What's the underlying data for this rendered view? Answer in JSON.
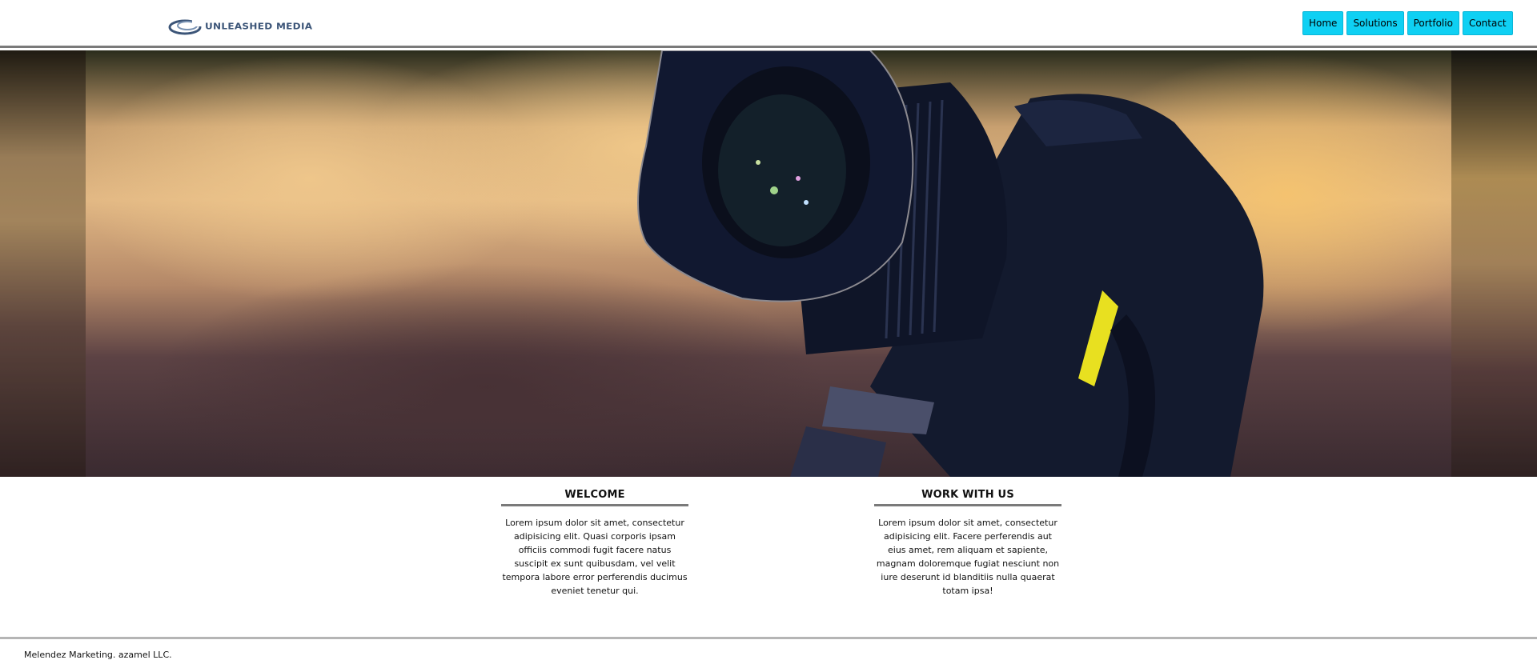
{
  "header": {
    "logo_text": "UNLEASHED MEDIA",
    "nav": [
      {
        "label": "Home"
      },
      {
        "label": "Solutions"
      },
      {
        "label": "Portfolio"
      },
      {
        "label": "Contact"
      }
    ],
    "nav_color": "#0fd0f3"
  },
  "hero": {
    "image": "camera-lens-photo"
  },
  "sections": {
    "welcome": {
      "title": "WELCOME",
      "body": "Lorem ipsum dolor sit amet, consectetur adipisicing elit. Quasi corporis ipsam officiis commodi fugit facere natus suscipit ex sunt quibusdam, vel velit tempora labore error perferendis ducimus eveniet tenetur qui."
    },
    "work": {
      "title": "WORK WITH US",
      "body": "Lorem ipsum dolor sit amet, consectetur adipisicing elit. Facere perferendis aut eius amet, rem aliquam et sapiente, magnam doloremque fugiat nesciunt non iure deserunt id blanditiis nulla quaerat totam ipsa!"
    }
  },
  "footer": {
    "text": "Melendez Marketing. azamel LLC."
  }
}
